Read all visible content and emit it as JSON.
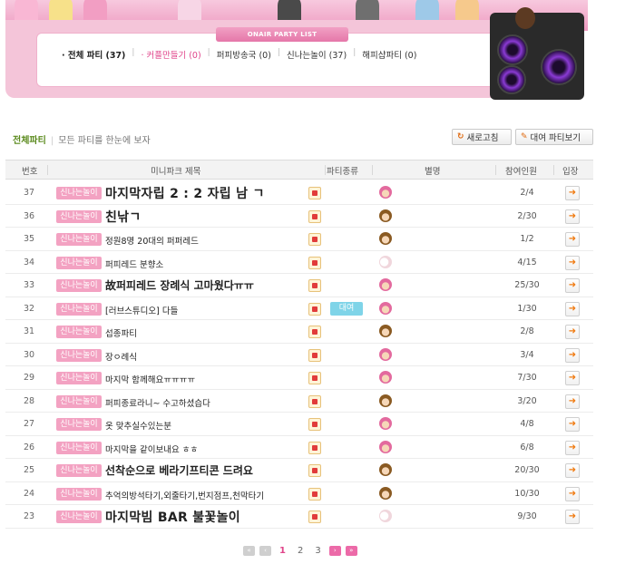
{
  "banner": {
    "tag": "ONAIR PARTY LIST",
    "nav": [
      {
        "label": "· 전체 파티 (37)",
        "state": "active"
      },
      {
        "label": "· 커플만들기 (0)",
        "state": "pink"
      },
      {
        "label": "퍼피방송국 (0)",
        "state": "normal"
      },
      {
        "label": "신나는놀이 (37)",
        "state": "normal"
      },
      {
        "label": "해피샵파티 (0)",
        "state": "normal"
      }
    ]
  },
  "toolbar": {
    "crumb_bold": "전체파티",
    "crumb_text": "모든 파티를 한눈에 보자",
    "refresh_icon": "↻",
    "refresh_label": "새로고침",
    "rental_icon": "✎",
    "rental_label": "대여 파티보기"
  },
  "table": {
    "headers": {
      "no": "번호",
      "title": "미니파크 제목",
      "type": "파티종류",
      "nick": "별명",
      "participants": "참여인원",
      "enter": "입장"
    },
    "rows": [
      {
        "no": "37",
        "tag": "신나는놀이",
        "title": "마지막자립 2 : 2 자립 남 ㄱ",
        "size": "l",
        "avatar": "pink",
        "rental": "",
        "participants": "2/4"
      },
      {
        "no": "36",
        "tag": "신나는놀이",
        "title": "친낚ㄱ",
        "size": "l",
        "avatar": "brown",
        "rental": "",
        "participants": "2/30"
      },
      {
        "no": "35",
        "tag": "신나는놀이",
        "title": "정원8명 20대의 퍼퍼레드",
        "size": "s",
        "avatar": "brown",
        "rental": "",
        "participants": "1/2"
      },
      {
        "no": "34",
        "tag": "신나는놀이",
        "title": "퍼피레드 분향소",
        "size": "s",
        "avatar": "faint",
        "rental": "",
        "participants": "4/15"
      },
      {
        "no": "33",
        "tag": "신나는놀이",
        "title": "故퍼피레드 장례식 고마웠다ㅠㅠ",
        "size": "m",
        "avatar": "pink",
        "rental": "",
        "participants": "25/30"
      },
      {
        "no": "32",
        "tag": "신나는놀이",
        "title": "[러브스튜디오] 다들",
        "size": "s",
        "avatar": "pink",
        "rental": "대여",
        "participants": "1/30"
      },
      {
        "no": "31",
        "tag": "신나는놀이",
        "title": "섭종파티",
        "size": "s",
        "avatar": "brown",
        "rental": "",
        "participants": "2/8"
      },
      {
        "no": "30",
        "tag": "신나는놀이",
        "title": "장ㅇ례식",
        "size": "s",
        "avatar": "pink",
        "rental": "",
        "participants": "3/4"
      },
      {
        "no": "29",
        "tag": "신나는놀이",
        "title": "마지막 함께해요ㅠㅠㅠㅠ",
        "size": "s",
        "avatar": "pink",
        "rental": "",
        "participants": "7/30"
      },
      {
        "no": "28",
        "tag": "신나는놀이",
        "title": "퍼피종료라니~ 수고하셨습다",
        "size": "s",
        "avatar": "brown",
        "rental": "",
        "participants": "3/20"
      },
      {
        "no": "27",
        "tag": "신나는놀이",
        "title": "옷 맞추실수있는분",
        "size": "s",
        "avatar": "pink",
        "rental": "",
        "participants": "4/8"
      },
      {
        "no": "26",
        "tag": "신나는놀이",
        "title": "마지막을 같이보내요 ㅎㅎ",
        "size": "s",
        "avatar": "pink",
        "rental": "",
        "participants": "6/8"
      },
      {
        "no": "25",
        "tag": "신나는놀이",
        "title": "선착순으로 베라기프티콘 드려요",
        "size": "m",
        "avatar": "brown",
        "rental": "",
        "participants": "20/30"
      },
      {
        "no": "24",
        "tag": "신나는놀이",
        "title": "추억의방석타기,외줄타기,번지점프,천막타기",
        "size": "s",
        "avatar": "brown",
        "rental": "",
        "participants": "10/30"
      },
      {
        "no": "23",
        "tag": "신나는놀이",
        "title": "마지막빔 BAR 불꽃놀이",
        "size": "l",
        "avatar": "faint",
        "rental": "",
        "participants": "9/30"
      }
    ]
  },
  "pagination": {
    "pages": [
      "1",
      "2",
      "3"
    ],
    "current": "1",
    "first_icon": "«",
    "prev_icon": "‹",
    "next_icon": "›",
    "last_icon": "»"
  },
  "colors": {
    "accent_pink": "#e0448a",
    "tag_pink": "#f3a2c2",
    "crumb_green": "#5a8a1c",
    "enter_orange": "#f07a10"
  }
}
